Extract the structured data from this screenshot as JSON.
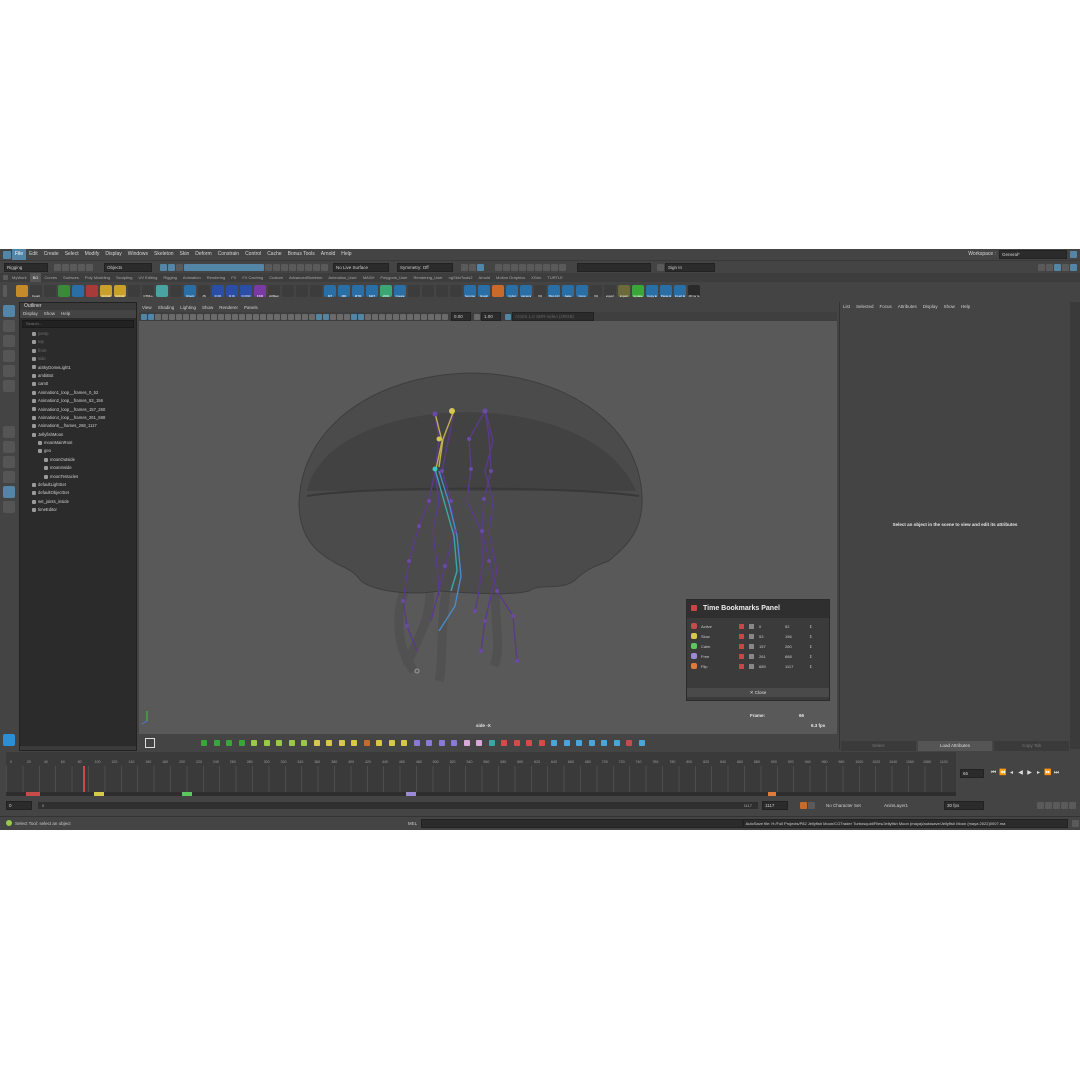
{
  "menubar": {
    "items": [
      "File",
      "Edit",
      "Create",
      "Select",
      "Modify",
      "Display",
      "Windows",
      "Skeleton",
      "Skin",
      "Deform",
      "Constrain",
      "Control",
      "Cache",
      "Bonus Tools",
      "Arnold",
      "Help"
    ],
    "workspace_label": "Workspace :",
    "workspace_value": "General*"
  },
  "statusline": {
    "mode": "Rigging",
    "objects": "Objects",
    "live_surface": "No Live Surface",
    "symmetry": "Symmetry: Off",
    "sign_in": "Sign In"
  },
  "shelf": {
    "tabs": [
      "MyWork",
      "BG",
      "Curves",
      "Surfaces",
      "Poly Modeling",
      "Sculpting",
      "UV Editing",
      "Rigging",
      "Animation",
      "Rendering",
      "FX",
      "FX Caching",
      "Custom",
      "AdvancedSkeleton",
      "Animation_User",
      "MASH",
      "Polygons_User",
      "Rendering_User",
      "ngSkinTools2",
      "Arnold",
      "Motion Graphics",
      "XGen",
      "TURTLE"
    ],
    "active_tab": "BG",
    "icons": [
      {
        "label": "",
        "color": "#c58b2a"
      },
      {
        "label": "Count",
        "color": "#3c3c3c"
      },
      {
        "label": "",
        "color": "#3c3c3c"
      },
      {
        "label": "",
        "color": "#3a8a3a"
      },
      {
        "label": "",
        "color": "#2a6ea6"
      },
      {
        "label": "",
        "color": "#a83a3a"
      },
      {
        "label": "OnFHF",
        "color": "#c8a02a"
      },
      {
        "label": "OnFHF",
        "color": "#c8a02a"
      },
      {
        "label": "",
        "color": "#3c3c3c"
      },
      {
        "label": "CTRLs",
        "color": "#3c3c3c"
      },
      {
        "label": "",
        "color": "#4aa3a3"
      },
      {
        "label": "",
        "color": "#3c3c3c"
      },
      {
        "label": "Orient",
        "color": "#2a6ea6"
      },
      {
        "label": "JS",
        "color": "#3c3c3c"
      },
      {
        "label": "D FK",
        "color": "#2a4ea6"
      },
      {
        "label": "D IK",
        "color": "#2a4ea6"
      },
      {
        "label": "D FKR",
        "color": "#2a4ea6"
      },
      {
        "label": "FKR",
        "color": "#7a3aa6"
      },
      {
        "label": "ctrlRem",
        "color": "#3c3c3c"
      },
      {
        "label": "",
        "color": "#3c3c3c"
      },
      {
        "label": "",
        "color": "#3c3c3c"
      },
      {
        "label": "",
        "color": "#3c3c3c"
      },
      {
        "label": "MT",
        "color": "#2a6ea6"
      },
      {
        "label": "MR",
        "color": "#2a6ea6"
      },
      {
        "label": "MTR",
        "color": "#2a6ea6"
      },
      {
        "label": "MAT",
        "color": "#2a6ea6"
      },
      {
        "label": "ZRO",
        "color": "#3aa676"
      },
      {
        "label": "Create",
        "color": "#2a6ea6"
      },
      {
        "label": "",
        "color": "#3c3c3c"
      },
      {
        "label": "",
        "color": "#3c3c3c"
      },
      {
        "label": "",
        "color": "#3c3c3c"
      },
      {
        "label": "",
        "color": "#3c3c3c"
      },
      {
        "label": "homme",
        "color": "#2a6ea6"
      },
      {
        "label": "Graph",
        "color": "#2a6ea6"
      },
      {
        "label": "",
        "color": "#c86a2a"
      },
      {
        "label": "CylLit",
        "color": "#2a6ea6"
      },
      {
        "label": "camera",
        "color": "#2a6ea6"
      },
      {
        "label": "Viz",
        "color": "#3c3c3c"
      },
      {
        "label": "Plot-Ctrl",
        "color": "#2a6ea6"
      },
      {
        "label": "bake",
        "color": "#2a6ea6"
      },
      {
        "label": "Cons",
        "color": "#2a6ea6"
      },
      {
        "label": "Viz",
        "color": "#3c3c3c"
      },
      {
        "label": "export",
        "color": "#3c3c3c"
      },
      {
        "label": "import",
        "color": "#6a6a3a"
      },
      {
        "label": "Update",
        "color": "#3aa63a"
      },
      {
        "label": "Copy E",
        "color": "#2a6ea6"
      },
      {
        "label": "Paste E",
        "color": "#2a6ea6"
      },
      {
        "label": "Invert E",
        "color": "#2a6ea6"
      },
      {
        "label": "Mirror E",
        "color": "#2a2a2a"
      }
    ]
  },
  "outliner": {
    "title": "Outliner",
    "menus": [
      "Display",
      "Show",
      "Help"
    ],
    "search_placeholder": "Search...",
    "items": [
      {
        "label": "persp",
        "dim": true,
        "indent": 1
      },
      {
        "label": "top",
        "dim": true,
        "indent": 1
      },
      {
        "label": "front",
        "dim": true,
        "indent": 1
      },
      {
        "label": "side",
        "dim": true,
        "indent": 1
      },
      {
        "label": "aiSkyDomeLight1",
        "dim": false,
        "indent": 1
      },
      {
        "label": "ambiBot",
        "dim": false,
        "indent": 1
      },
      {
        "label": "cam0",
        "dim": false,
        "indent": 1
      },
      {
        "label": "Animation1_loop__frames_0_52",
        "dim": false,
        "indent": 1
      },
      {
        "label": "Animation2_loop__frames_53_156",
        "dim": false,
        "indent": 1
      },
      {
        "label": "Animation3_loop__frames_157_260",
        "dim": false,
        "indent": 1
      },
      {
        "label": "Animation4_loop__frames_261_688",
        "dim": false,
        "indent": 1
      },
      {
        "label": "Animation5__frames_268_1117",
        "dim": false,
        "indent": 1
      },
      {
        "label": "JellyfishMoon",
        "dim": false,
        "indent": 1
      },
      {
        "label": "moonMainRoot",
        "dim": false,
        "indent": 2
      },
      {
        "label": "geo",
        "dim": false,
        "indent": 2
      },
      {
        "label": "moonOutside",
        "dim": false,
        "indent": 3
      },
      {
        "label": "moonInside",
        "dim": false,
        "indent": 3
      },
      {
        "label": "moonTentacles",
        "dim": false,
        "indent": 3
      },
      {
        "label": "defaultLightSet",
        "dim": false,
        "indent": 1
      },
      {
        "label": "defaultObjectSet",
        "dim": false,
        "indent": 1
      },
      {
        "label": "set_joints_inside",
        "dim": false,
        "indent": 1
      },
      {
        "label": "timeEditor",
        "dim": false,
        "indent": 1
      }
    ]
  },
  "viewport": {
    "menus": [
      "View",
      "Shading",
      "Lighting",
      "Show",
      "Renderer",
      "Panels"
    ],
    "exposure": "0.00",
    "gamma": "1.00",
    "color_space": "ACES 1.0 SDR-video (sRGB)",
    "camera_label": "side -X",
    "frames_label": "Frame:",
    "frame_value": "66",
    "fps_value": "6.3 fps"
  },
  "bookmarks": {
    "title": "Time Bookmarks Panel",
    "rows": [
      {
        "name": "Active",
        "color": "#c84a4a",
        "start": "0",
        "end": "52"
      },
      {
        "name": "Slow",
        "color": "#d8c84a",
        "start": "53",
        "end": "156"
      },
      {
        "name": "Calm",
        "color": "#5ac85a",
        "start": "157",
        "end": "260"
      },
      {
        "name": "Free",
        "color": "#9a8ad8",
        "start": "261",
        "end": "688"
      },
      {
        "name": "Flip",
        "color": "#e07a3a",
        "start": "689",
        "end": "1117"
      }
    ],
    "close_label": "Close"
  },
  "attribute_editor": {
    "menus": [
      "List",
      "Selected",
      "Focus",
      "Attributes",
      "Display",
      "Show",
      "Help"
    ],
    "message": "Select an object in the scene to view and edit its attributes",
    "buttons": [
      "Select",
      "Load Attributes",
      "Copy Tab"
    ]
  },
  "timeslider": {
    "ticks": [
      "0",
      "20",
      "40",
      "60",
      "80",
      "100",
      "120",
      "140",
      "160",
      "180",
      "200",
      "220",
      "240",
      "260",
      "280",
      "300",
      "320",
      "340",
      "360",
      "380",
      "400",
      "420",
      "440",
      "460",
      "480",
      "500",
      "520",
      "540",
      "560",
      "580",
      "600",
      "620",
      "640",
      "660",
      "680",
      "700",
      "720",
      "740",
      "760",
      "780",
      "800",
      "820",
      "840",
      "860",
      "880",
      "900",
      "920",
      "940",
      "960",
      "980",
      "1000",
      "1020",
      "1040",
      "1060",
      "1080",
      "1100"
    ],
    "current_frame": "66"
  },
  "range": {
    "start": "0",
    "inner_start": "0",
    "inner_end": "1117",
    "end": "1117",
    "character_set": "No Character Set",
    "anim_layer": "AnimLayer1",
    "fps": "30 fps"
  },
  "commandline": {
    "help": "Select Tool: select an object",
    "lang": "MEL",
    "autosave": "AutoSave file: H:/Full Projects/P82 Jellyfish Moon/CGTrader Turbosquid/Files/Jellyfish Moon (maya)/autosave/Jellyfish Moon (maya 2022)0007.ma"
  }
}
